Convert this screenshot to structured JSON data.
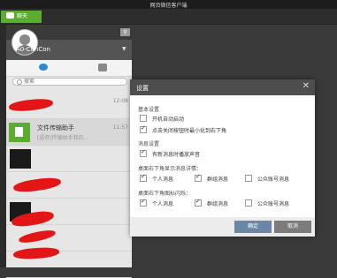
{
  "window": {
    "title": "网页微信客户端"
  },
  "tab": {
    "label": "聊天"
  },
  "user": {
    "name": "A0-ConCon"
  },
  "search": {
    "placeholder": "搜索"
  },
  "chats": [
    {
      "time": "12:08"
    },
    {
      "title": "文件传输助手",
      "preview": "[语音]传输助手我的...",
      "time": "11:57"
    }
  ],
  "settings": {
    "title": "设置",
    "sections": [
      {
        "label": "基本设置",
        "options": [
          {
            "label": "开机自动启动",
            "checked": false
          },
          {
            "label": "点击关闭按钮时最小化到右下角",
            "checked": true
          }
        ]
      },
      {
        "label": "消息设置",
        "options": [
          {
            "label": "有新消息时播放声音",
            "checked": true
          }
        ]
      },
      {
        "label": "桌面右下角显示消息详情：",
        "options": [
          {
            "label": "个人消息",
            "checked": true
          },
          {
            "label": "群组消息",
            "checked": true
          },
          {
            "label": "公众账号消息",
            "checked": false
          }
        ]
      },
      {
        "label": "桌面右下角图标闪烁：",
        "options": [
          {
            "label": "个人消息",
            "checked": true
          },
          {
            "label": "群组消息",
            "checked": true
          },
          {
            "label": "公众账号消息",
            "checked": false
          }
        ]
      }
    ],
    "ok_label": "确定",
    "cancel_label": "取消"
  }
}
